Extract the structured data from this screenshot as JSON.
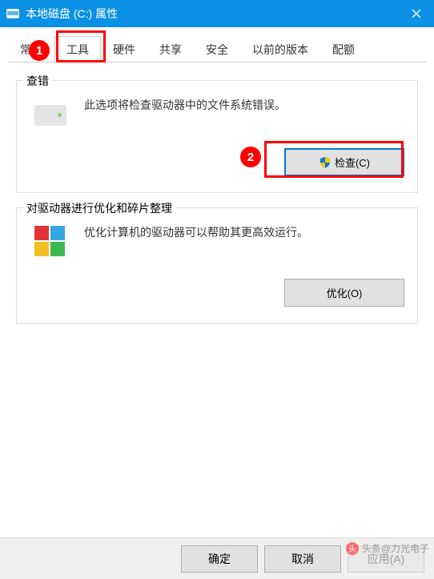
{
  "window": {
    "title": "本地磁盘 (C:) 属性"
  },
  "tabs": {
    "t0": "常规",
    "t1": "工具",
    "t2": "硬件",
    "t3": "共享",
    "t4": "安全",
    "t5": "以前的版本",
    "t6": "配额"
  },
  "check": {
    "group_label": "查错",
    "description": "此选项将检查驱动器中的文件系统错误。",
    "button": "检查(C)"
  },
  "optimize": {
    "group_label": "对驱动器进行优化和碎片整理",
    "description": "优化计算机的驱动器可以帮助其更高效运行。",
    "button": "优化(O)"
  },
  "buttons": {
    "ok": "确定",
    "cancel": "取消",
    "apply": "应用(A)"
  },
  "annotations": {
    "n1": "1",
    "n2": "2"
  },
  "watermark": {
    "text": "头条@力光电子"
  }
}
